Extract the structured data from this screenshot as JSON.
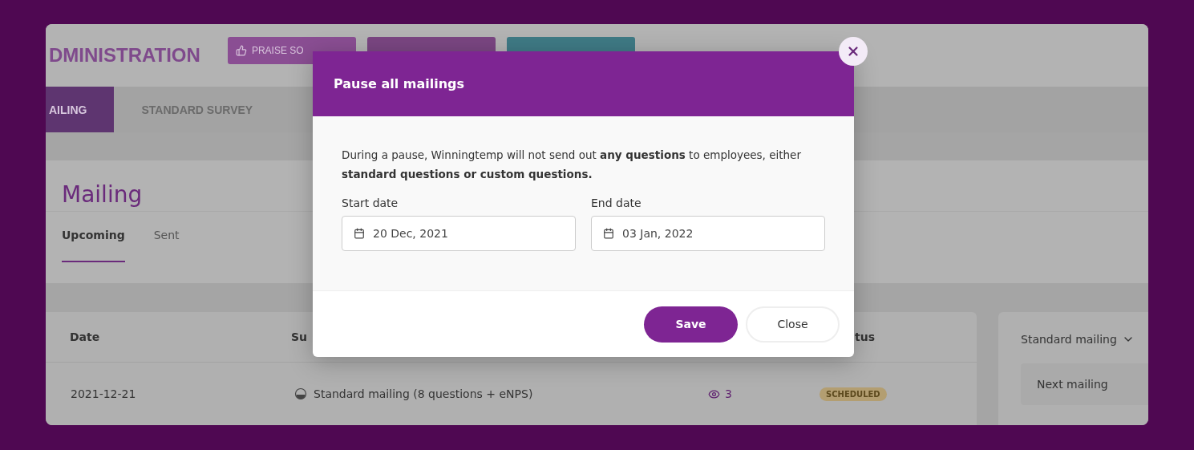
{
  "header": {
    "title": "DMINISTRATION",
    "buttons": [
      {
        "label": "PRAISE SO",
        "color": "#8a4e93"
      },
      {
        "color": "#7a4682"
      },
      {
        "color": "#3f7a85"
      }
    ]
  },
  "nav": [
    {
      "label": "AILING",
      "selected": true
    },
    {
      "label": "STANDARD SURVEY",
      "selected": false
    }
  ],
  "page": {
    "title": "Mailing",
    "tabs": [
      {
        "label": "Upcoming",
        "selected": true
      },
      {
        "label": "Sent",
        "selected": false
      }
    ]
  },
  "table": {
    "columns": [
      "Date",
      "Su",
      "tus"
    ],
    "rows": [
      {
        "date": "2021-12-21",
        "survey": "Standard mailing (8 questions + eNPS)",
        "views": "3",
        "status": "SCHEDULED"
      }
    ]
  },
  "side": {
    "dropdown": "Standard mailing",
    "item": "Next mailing"
  },
  "modal": {
    "title": "Pause all mailings",
    "text": "During a pause, Winningtemp will not send out **any questions** to employees, either **standard questions or custom questions.**",
    "fields": [
      {
        "label": "Start date",
        "value": "20 Dec, 2021"
      },
      {
        "label": "End date",
        "value": "03 Jan, 2022"
      }
    ],
    "save": "Save",
    "close": "Close"
  }
}
